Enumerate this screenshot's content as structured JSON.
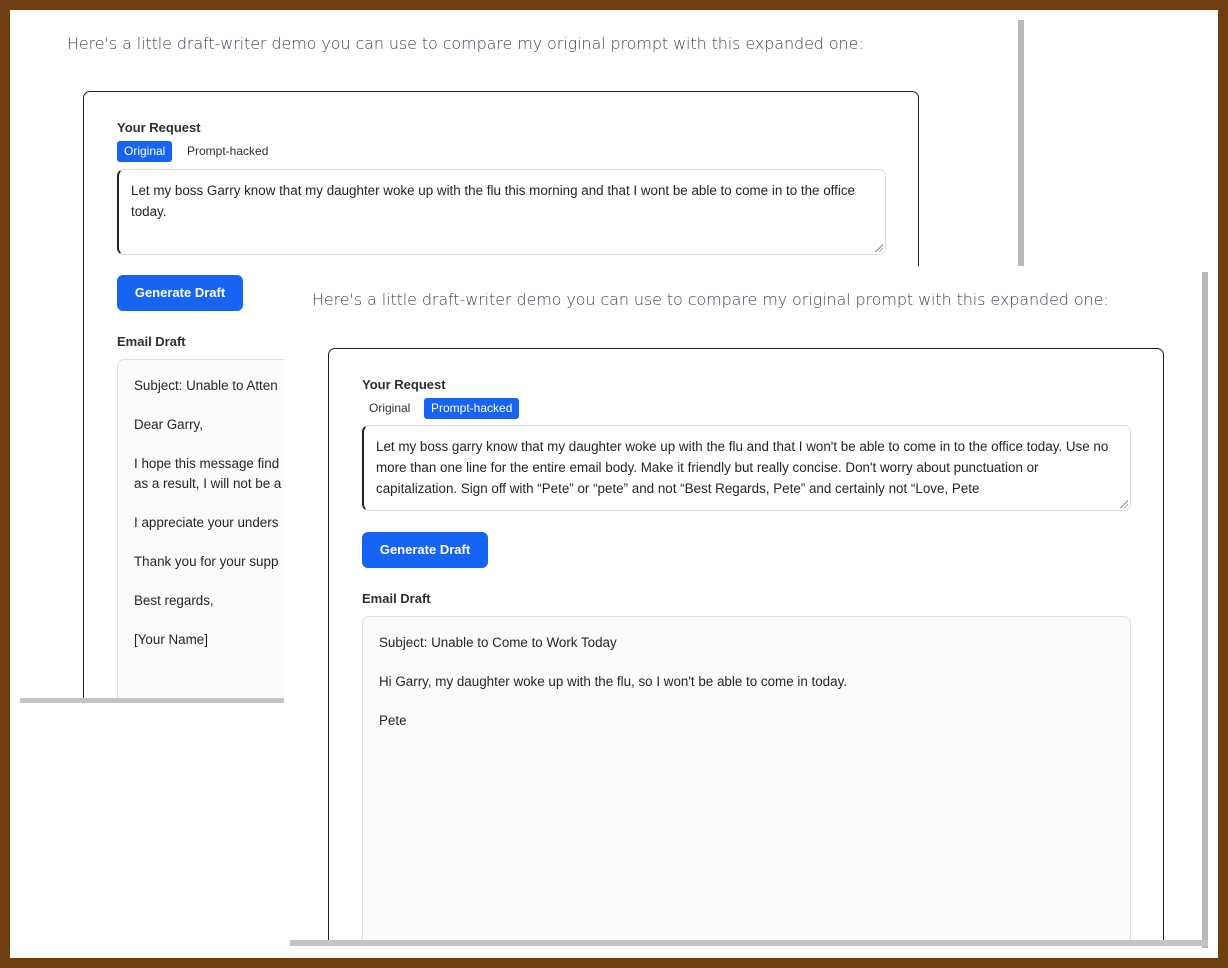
{
  "back": {
    "intro": "Here's a little draft-writer demo you can use to compare my original prompt with this expanded one:",
    "request_label": "Your Request",
    "tabs": [
      {
        "label": "Original",
        "active": true
      },
      {
        "label": "Prompt-hacked",
        "active": false
      }
    ],
    "request_text": "Let my boss Garry know that my daughter woke up with the flu this morning and that I wont be able to come in to the office today.",
    "generate_label": "Generate Draft",
    "draft_label": "Email Draft",
    "draft_lines": [
      "Subject: Unable to Atten",
      "Dear Garry,",
      "I hope this message find",
      "as a result, I will not be a",
      "I appreciate your unders",
      "Thank you for your supp",
      "Best regards,",
      "[Your Name]"
    ]
  },
  "front": {
    "intro": "Here's a little draft-writer demo you can use to compare my original prompt with this expanded one:",
    "request_label": "Your Request",
    "tabs": [
      {
        "label": "Original",
        "active": false
      },
      {
        "label": "Prompt-hacked",
        "active": true
      }
    ],
    "request_text": "Let my boss garry know that my daughter woke up with the flu and that I won't be able to come in to the office today. Use no more than one line for the entire email body. Make it friendly but really concise. Don't worry about punctuation or capitalization. Sign off with “Pete” or “pete” and not “Best Regards, Pete” and certainly not “Love, Pete",
    "generate_label": "Generate Draft",
    "draft_label": "Email Draft",
    "draft_lines": [
      "Subject: Unable to Come to Work Today",
      "Hi Garry, my daughter woke up with the flu, so I won't be able to come in today.",
      "Pete"
    ]
  },
  "colors": {
    "accent": "#1763f2",
    "frame": "#6f3f12"
  }
}
